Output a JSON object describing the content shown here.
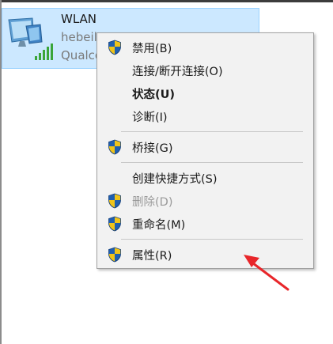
{
  "network": {
    "name": "WLAN",
    "ssid_partial": "hebeil",
    "adapter_partial": "Qualco"
  },
  "menu": {
    "items": [
      {
        "label": "禁用(B)",
        "shield": true,
        "style": "normal"
      },
      {
        "label": "连接/断开连接(O)",
        "shield": false,
        "style": "normal"
      },
      {
        "label": "状态(U)",
        "shield": false,
        "style": "bold"
      },
      {
        "label": "诊断(I)",
        "shield": false,
        "style": "normal"
      },
      {
        "label": "桥接(G)",
        "shield": true,
        "style": "normal"
      },
      {
        "label": "创建快捷方式(S)",
        "shield": false,
        "style": "normal"
      },
      {
        "label": "删除(D)",
        "shield": true,
        "style": "disabled"
      },
      {
        "label": "重命名(M)",
        "shield": true,
        "style": "normal"
      },
      {
        "label": "属性(R)",
        "shield": true,
        "style": "normal"
      }
    ]
  },
  "colors": {
    "selection_bg": "#cce8ff",
    "menu_bg": "#f2f2f2",
    "annotation_arrow": "#e8262a"
  },
  "icons": {
    "network_adapter": "network-adapter-icon",
    "signal": "wifi-signal-icon",
    "uac_shield": "uac-shield-icon"
  }
}
